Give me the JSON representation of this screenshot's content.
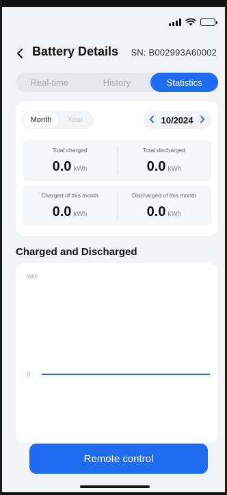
{
  "status_bar": {
    "icons": [
      "cellular-signal-icon",
      "wifi-icon",
      "battery-icon"
    ]
  },
  "header": {
    "back_icon": "chevron-left-icon",
    "title": "Battery Details",
    "sn": "SN: B002993A60002"
  },
  "tabs": [
    {
      "label": "Real-time",
      "active": false
    },
    {
      "label": "History",
      "active": false
    },
    {
      "label": "Statistics",
      "active": true
    }
  ],
  "period_toggle": {
    "month_label": "Month",
    "year_label": "Year",
    "selected": "Month"
  },
  "date_picker": {
    "prev_icon": "chevron-left-icon",
    "value": "10/2024",
    "next_icon": "chevron-right-icon"
  },
  "stats": {
    "total_charged": {
      "label": "Total charged",
      "value": "0.0",
      "unit": "kWh"
    },
    "total_discharged": {
      "label": "Total discharged",
      "value": "0.0",
      "unit": "kWh"
    },
    "charged_month": {
      "label": "Charged of this month",
      "value": "0.0",
      "unit": "kWh"
    },
    "discharged_month": {
      "label": "Discharged of this month",
      "value": "0.0",
      "unit": "kWh"
    }
  },
  "chart_section": {
    "title": "Charged and Discharged"
  },
  "chart_data": {
    "type": "line",
    "title": "",
    "ylabel": "kWh",
    "xlabel": "",
    "y_ticks": [
      "0"
    ],
    "series": [
      {
        "values": [
          0,
          0
        ]
      }
    ],
    "line_color": "#1f6cf0",
    "grid": false
  },
  "footer": {
    "remote_button": "Remote control"
  },
  "colors": {
    "accent": "#1f6cf0",
    "background": "#f2f3f5"
  }
}
